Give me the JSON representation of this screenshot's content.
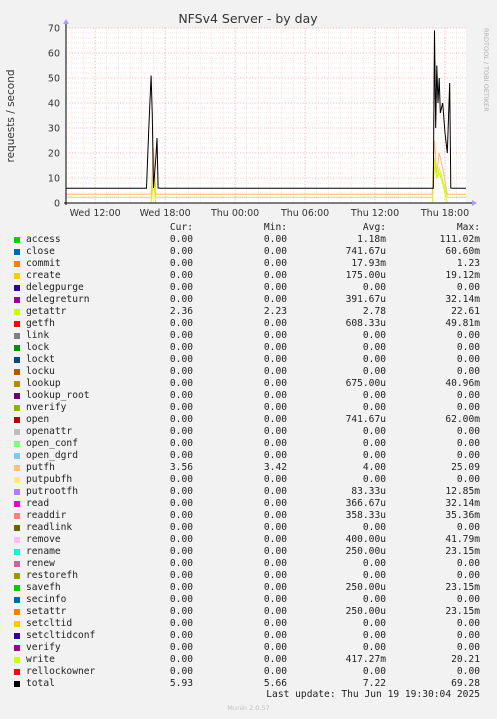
{
  "chart_data": {
    "type": "line",
    "title": "NFSv4 Server - by day",
    "ylabel": "requests / second",
    "watermark": "RRDTOOL / TOBI OETIKER",
    "ylim": [
      0,
      70
    ],
    "yticks": [
      0,
      10,
      20,
      30,
      40,
      50,
      60,
      70
    ],
    "xticks": [
      "Wed 12:00",
      "Wed 18:00",
      "Thu 00:00",
      "Thu 06:00",
      "Thu 12:00",
      "Thu 18:00"
    ],
    "x_range_hours": [
      9.5,
      43.8
    ],
    "grid": true,
    "series": [
      {
        "name": "total",
        "color": "#000000",
        "x": [
          9.5,
          16.4,
          16.6,
          16.8,
          16.9,
          17.0,
          17.2,
          17.3,
          17.4,
          17.6,
          17.8,
          40.8,
          41.0,
          41.1,
          41.2,
          41.3,
          41.4,
          41.5,
          41.6,
          41.8,
          42.0,
          42.2,
          42.4,
          42.5,
          42.6,
          42.8,
          43.8
        ],
        "y": [
          5.9,
          5.9,
          30,
          51,
          35,
          6,
          18,
          26,
          6,
          5.9,
          5.9,
          5.9,
          5.9,
          69,
          30,
          55,
          40,
          50,
          36,
          40,
          28,
          20,
          48,
          6,
          5.9,
          5.9,
          5.9
        ]
      },
      {
        "name": "putfh",
        "color": "#ffbb78",
        "x": [
          9.5,
          16.8,
          17.0,
          17.2,
          40.9,
          41.1,
          41.3,
          41.5,
          41.8,
          42.2,
          43.8
        ],
        "y": [
          3.5,
          3.5,
          22,
          3.5,
          3.5,
          25,
          12,
          20,
          14,
          3.5,
          3.5
        ]
      },
      {
        "name": "getattr",
        "color": "#ccff00",
        "x": [
          9.5,
          16.8,
          17.0,
          17.2,
          40.9,
          41.1,
          41.3,
          41.5,
          41.8,
          42.2,
          43.8
        ],
        "y": [
          2.3,
          2.3,
          12,
          2.3,
          2.3,
          18,
          10,
          14,
          9,
          2.3,
          2.3
        ]
      },
      {
        "name": "write",
        "color": "#ccff00",
        "x": [
          9.5,
          16.8,
          17.0,
          17.2,
          40.9,
          41.1,
          41.3,
          41.5,
          41.8,
          42.2,
          43.8
        ],
        "y": [
          0,
          0,
          8,
          0,
          0,
          15,
          10,
          12,
          8,
          0,
          0
        ]
      }
    ]
  },
  "legend": {
    "headers": [
      "Cur:",
      "Min:",
      "Avg:",
      "Max:"
    ],
    "rows": [
      {
        "name": "access",
        "color": "#00cc00",
        "cur": "0.00",
        "min": "0.00",
        "avg": "1.18m",
        "max": "111.02m"
      },
      {
        "name": "close",
        "color": "#0066b3",
        "cur": "0.00",
        "min": "0.00",
        "avg": "741.67u",
        "max": "60.60m"
      },
      {
        "name": "commit",
        "color": "#ff8000",
        "cur": "0.00",
        "min": "0.00",
        "avg": "17.93m",
        "max": "1.23"
      },
      {
        "name": "create",
        "color": "#ffcc00",
        "cur": "0.00",
        "min": "0.00",
        "avg": "175.00u",
        "max": "19.12m"
      },
      {
        "name": "delegpurge",
        "color": "#330099",
        "cur": "0.00",
        "min": "0.00",
        "avg": "0.00",
        "max": "0.00"
      },
      {
        "name": "delegreturn",
        "color": "#990099",
        "cur": "0.00",
        "min": "0.00",
        "avg": "391.67u",
        "max": "32.14m"
      },
      {
        "name": "getattr",
        "color": "#ccff00",
        "cur": "2.36",
        "min": "2.23",
        "avg": "2.78",
        "max": "22.61"
      },
      {
        "name": "getfh",
        "color": "#ff0000",
        "cur": "0.00",
        "min": "0.00",
        "avg": "608.33u",
        "max": "49.81m"
      },
      {
        "name": "link",
        "color": "#808080",
        "cur": "0.00",
        "min": "0.00",
        "avg": "0.00",
        "max": "0.00"
      },
      {
        "name": "lock",
        "color": "#008f00",
        "cur": "0.00",
        "min": "0.00",
        "avg": "0.00",
        "max": "0.00"
      },
      {
        "name": "lockt",
        "color": "#00487d",
        "cur": "0.00",
        "min": "0.00",
        "avg": "0.00",
        "max": "0.00"
      },
      {
        "name": "locku",
        "color": "#b35a00",
        "cur": "0.00",
        "min": "0.00",
        "avg": "0.00",
        "max": "0.00"
      },
      {
        "name": "lookup",
        "color": "#b38f00",
        "cur": "0.00",
        "min": "0.00",
        "avg": "675.00u",
        "max": "40.96m"
      },
      {
        "name": "lookup_root",
        "color": "#6b006b",
        "cur": "0.00",
        "min": "0.00",
        "avg": "0.00",
        "max": "0.00"
      },
      {
        "name": "nverify",
        "color": "#8fb300",
        "cur": "0.00",
        "min": "0.00",
        "avg": "0.00",
        "max": "0.00"
      },
      {
        "name": "open",
        "color": "#b30000",
        "cur": "0.00",
        "min": "0.00",
        "avg": "741.67u",
        "max": "62.00m"
      },
      {
        "name": "openattr",
        "color": "#bebebe",
        "cur": "0.00",
        "min": "0.00",
        "avg": "0.00",
        "max": "0.00"
      },
      {
        "name": "open_conf",
        "color": "#80ff80",
        "cur": "0.00",
        "min": "0.00",
        "avg": "0.00",
        "max": "0.00"
      },
      {
        "name": "open_dgrd",
        "color": "#80c9ff",
        "cur": "0.00",
        "min": "0.00",
        "avg": "0.00",
        "max": "0.00"
      },
      {
        "name": "putfh",
        "color": "#ffc080",
        "cur": "3.56",
        "min": "3.42",
        "avg": "4.00",
        "max": "25.09"
      },
      {
        "name": "putpubfh",
        "color": "#ffe680",
        "cur": "0.00",
        "min": "0.00",
        "avg": "0.00",
        "max": "0.00"
      },
      {
        "name": "putrootfh",
        "color": "#aa80ff",
        "cur": "0.00",
        "min": "0.00",
        "avg": "83.33u",
        "max": "12.85m"
      },
      {
        "name": "read",
        "color": "#ee00cc",
        "cur": "0.00",
        "min": "0.00",
        "avg": "366.67u",
        "max": "32.14m"
      },
      {
        "name": "readdir",
        "color": "#ff8080",
        "cur": "0.00",
        "min": "0.00",
        "avg": "358.33u",
        "max": "35.36m"
      },
      {
        "name": "readlink",
        "color": "#666600",
        "cur": "0.00",
        "min": "0.00",
        "avg": "0.00",
        "max": "0.00"
      },
      {
        "name": "remove",
        "color": "#ffbfff",
        "cur": "0.00",
        "min": "0.00",
        "avg": "400.00u",
        "max": "41.79m"
      },
      {
        "name": "rename",
        "color": "#00ffcc",
        "cur": "0.00",
        "min": "0.00",
        "avg": "250.00u",
        "max": "23.15m"
      },
      {
        "name": "renew",
        "color": "#cc6699",
        "cur": "0.00",
        "min": "0.00",
        "avg": "0.00",
        "max": "0.00"
      },
      {
        "name": "restorefh",
        "color": "#999900",
        "cur": "0.00",
        "min": "0.00",
        "avg": "0.00",
        "max": "0.00"
      },
      {
        "name": "savefh",
        "color": "#00cc00",
        "cur": "0.00",
        "min": "0.00",
        "avg": "250.00u",
        "max": "23.15m"
      },
      {
        "name": "secinfo",
        "color": "#0066b3",
        "cur": "0.00",
        "min": "0.00",
        "avg": "0.00",
        "max": "0.00"
      },
      {
        "name": "setattr",
        "color": "#ff8000",
        "cur": "0.00",
        "min": "0.00",
        "avg": "250.00u",
        "max": "23.15m"
      },
      {
        "name": "setcltid",
        "color": "#ffcc00",
        "cur": "0.00",
        "min": "0.00",
        "avg": "0.00",
        "max": "0.00"
      },
      {
        "name": "setcltidconf",
        "color": "#330099",
        "cur": "0.00",
        "min": "0.00",
        "avg": "0.00",
        "max": "0.00"
      },
      {
        "name": "verify",
        "color": "#990099",
        "cur": "0.00",
        "min": "0.00",
        "avg": "0.00",
        "max": "0.00"
      },
      {
        "name": "write",
        "color": "#ccff00",
        "cur": "0.00",
        "min": "0.00",
        "avg": "417.27m",
        "max": "20.21"
      },
      {
        "name": "rellockowner",
        "color": "#ff0000",
        "cur": "0.00",
        "min": "0.00",
        "avg": "0.00",
        "max": "0.00"
      },
      {
        "name": "total",
        "color": "#000000",
        "cur": "5.93",
        "min": "5.66",
        "avg": "7.22",
        "max": "69.28"
      }
    ]
  },
  "footer": {
    "last_update": "Last update: Thu Jun 19 19:30:04 2025",
    "version": "Munin 2.0.57"
  }
}
